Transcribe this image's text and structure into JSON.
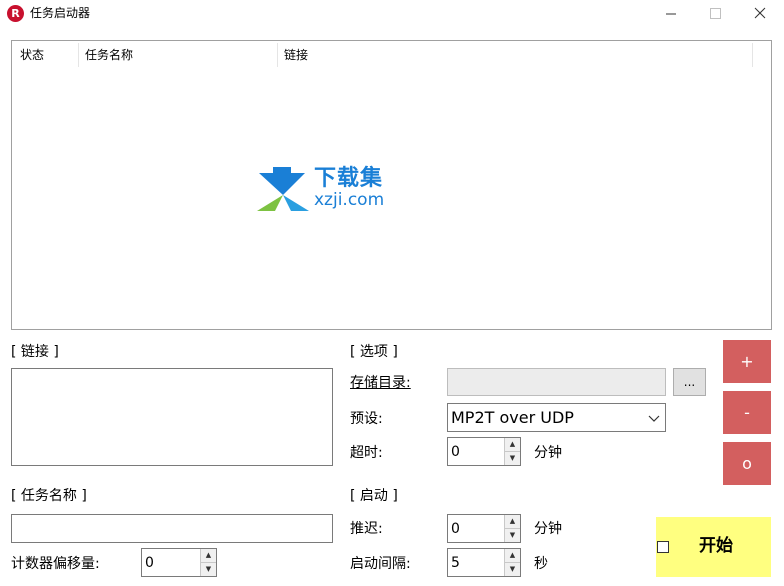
{
  "window": {
    "title": "任务启动器",
    "icon_letter": "R",
    "minimize_icon": "minimize-icon",
    "maximize_icon": "maximize-icon",
    "close_icon": "close-icon"
  },
  "listview": {
    "columns": [
      "状态",
      "任务名称",
      "链接"
    ],
    "rows": []
  },
  "watermark": {
    "text_cn": "下载集",
    "text_url": "xzji.com"
  },
  "links_section": {
    "header": "[ 链接 ]",
    "value": ""
  },
  "taskname_section": {
    "header": "[ 任务名称 ]",
    "value": ""
  },
  "counter_offset": {
    "label": "计数器偏移量:",
    "value": "0"
  },
  "options_section": {
    "header": "[ 选项 ]",
    "storage_dir_label": "存储目录:",
    "storage_dir_value": "",
    "browse_label": "...",
    "preset_label": "预设:",
    "preset_value": "MP2T over UDP",
    "timeout_label": "超时:",
    "timeout_value": "0",
    "timeout_unit": "分钟"
  },
  "start_section": {
    "header": "[ 启动 ]",
    "delay_label": "推迟:",
    "delay_value": "0",
    "delay_unit": "分钟",
    "interval_label": "启动间隔:",
    "interval_value": "5",
    "interval_unit": "秒"
  },
  "side_buttons": {
    "add": "+",
    "remove": "-",
    "reset": "o"
  },
  "start_button": {
    "label": "开始",
    "checked": false
  },
  "colors": {
    "side_button_bg": "#d35f5f",
    "start_button_bg": "#ffff80",
    "watermark": "#1a7fd6"
  }
}
